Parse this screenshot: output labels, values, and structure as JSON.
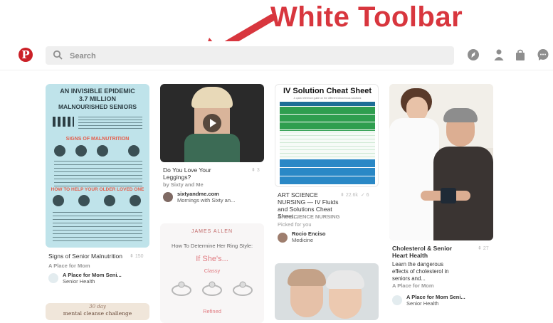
{
  "annotation": {
    "text": "White Toolbar",
    "color": "#d8363e"
  },
  "toolbar": {
    "logo": "P",
    "search_placeholder": "Search",
    "icons": [
      "compass-icon",
      "person-icon",
      "bag-icon",
      "chat-icon"
    ]
  },
  "pins": [
    {
      "poster_title_1": "AN INVISIBLE EPIDEMIC",
      "poster_title_2": "3.7 MILLION",
      "poster_title_3": "MALNOURISHED SENIORS",
      "poster_heading_signs": "SIGNS OF MALNUTRITION",
      "poster_heading_help": "HOW TO HELP YOUR OLDER LOVED ONE",
      "title": "Signs of Senior Malnutrition",
      "count": "150",
      "source": "A Place for Mom",
      "attr_name": "A Place for Mom Seni...",
      "attr_board": "Senior Health"
    },
    {
      "title": "Do You Love Your Leggings?",
      "count": "3",
      "by": "by Sixty and Me",
      "attr_name": "sixtyandme.com",
      "attr_board": "Mornings with Sixty an..."
    },
    {
      "brand": "JAMES ALLEN",
      "heading": "How To Determine Her Ring Style:",
      "subheading": "If She's...",
      "style1": "Classy",
      "style2": "Refined"
    },
    {
      "poster_title": "IV Solution Cheat Sheet",
      "poster_sub": "A quick reference guide on the different intravenous solutions",
      "title": "ART SCIENCE NURSING — IV Fluids and Solutions Cheat Sheet...",
      "count": "22.6k",
      "likes": "6",
      "source": "ART SCIENCE NURSING",
      "picked": "Picked for you",
      "attr_name": "Rocio Enciso",
      "attr_board": "Medicine"
    },
    {
      "title": "Cholesterol & Senior Heart Health",
      "count": "27",
      "desc": "Learn the dangerous effects of cholesterol in seniors and...",
      "source": "A Place for Mom",
      "attr_name": "A Place for Mom Seni...",
      "attr_board": "Senior Health"
    },
    {
      "banner_top": "30 day",
      "banner_text": "mental cleanse challenge"
    }
  ]
}
